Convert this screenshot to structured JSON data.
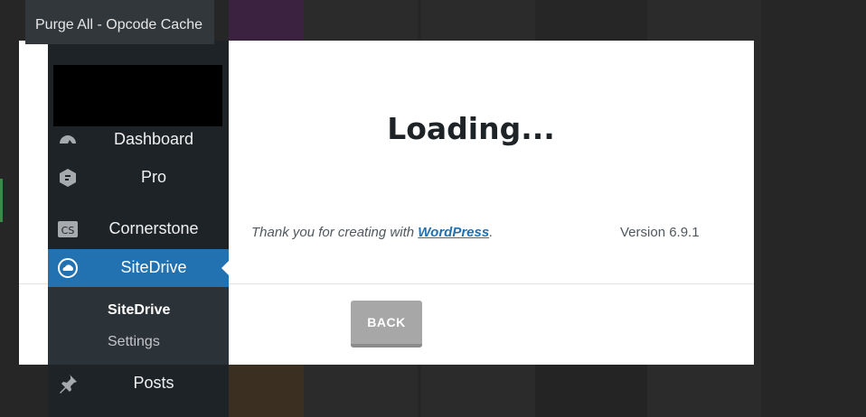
{
  "tooltip": {
    "partial_label": "",
    "item_label": "Purge All - Opcode Cache"
  },
  "modal": {
    "title": "Loading...",
    "footer_thanks_prefix": "Thank you for creating with ",
    "footer_link": "WordPress",
    "footer_suffix": ".",
    "version": "Version 6.9.1",
    "back_label": "BACK"
  },
  "sidebar": {
    "items": [
      {
        "label": "Dashboard",
        "icon": "dashboard-icon"
      },
      {
        "label": "Pro",
        "icon": "pro-shield-icon"
      },
      {
        "label": "Cornerstone",
        "icon": "cornerstone-cs-icon"
      },
      {
        "label": "SiteDrive",
        "icon": "sitedrive-cloud-icon",
        "active": true
      },
      {
        "label": "Posts",
        "icon": "pin-icon"
      }
    ],
    "submenu": [
      {
        "label": "SiteDrive",
        "current": true
      },
      {
        "label": "Settings"
      }
    ]
  },
  "colors": {
    "accent": "#2271b1",
    "sidebar_bg": "#1d2327",
    "button_gray": "#a7a7a7"
  }
}
